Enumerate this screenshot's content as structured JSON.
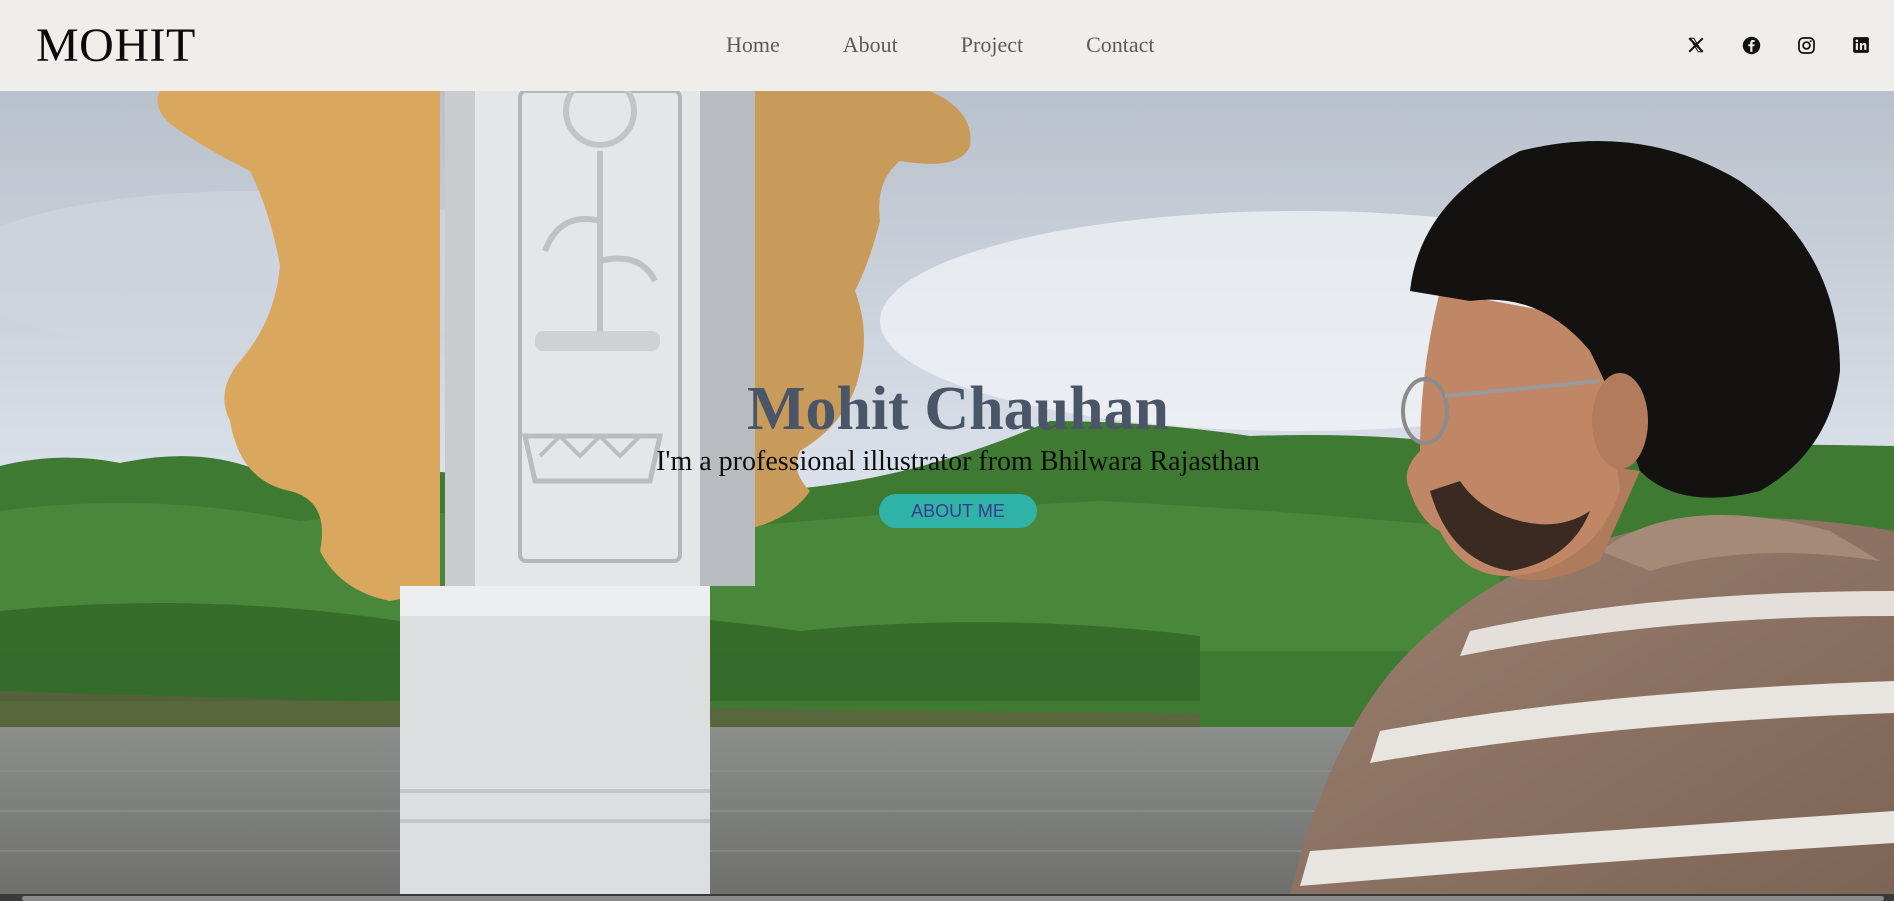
{
  "site": {
    "logo": "MOHIT"
  },
  "nav": {
    "items": [
      "Home",
      "About",
      "Project",
      "Contact"
    ]
  },
  "social": [
    "x-icon",
    "facebook-icon",
    "instagram-icon",
    "linkedin-icon"
  ],
  "hero": {
    "name": "Mohit Chauhan",
    "tagline": "I'm a professional illustrator from Bhilwara Rajasthan",
    "button_label": "ABOUT ME"
  },
  "colors": {
    "nav_bg": "#efeeeb",
    "name": "#4a5668",
    "button_bg": "#2fb3a6",
    "button_text": "#3b3b8f"
  }
}
